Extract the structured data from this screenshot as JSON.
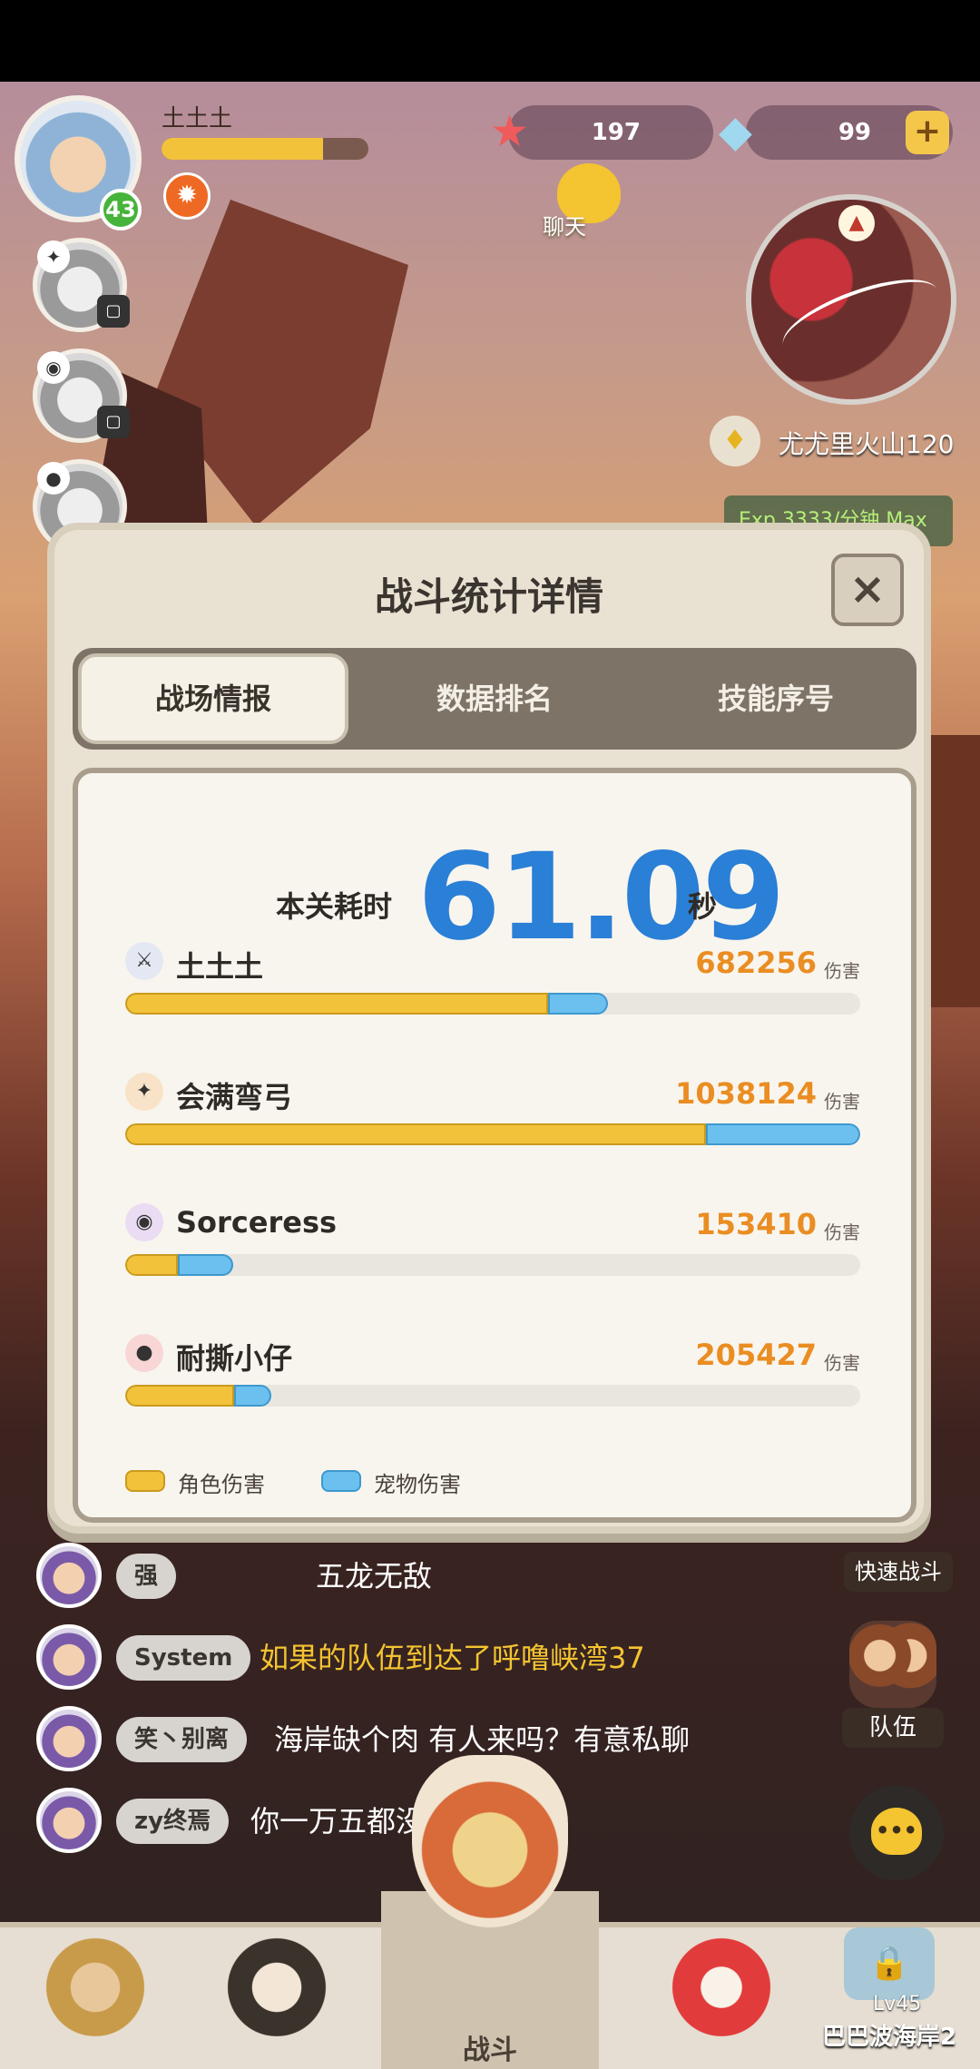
{
  "hud": {
    "player_name": "土土土",
    "player_level": "43",
    "exp_fraction": 0.78,
    "starfish_count": "197",
    "shell_count": "99",
    "chat_label": "聊天",
    "location_name": "尤尤里火山120",
    "exp_rate": "Exp 3333/分钟 Max"
  },
  "modal": {
    "title": "战斗统计详情",
    "close_label": "×",
    "tabs": [
      {
        "label": "战场情报",
        "active": true
      },
      {
        "label": "数据排名",
        "active": false
      },
      {
        "label": "技能序号",
        "active": false
      }
    ],
    "time_label": "本关耗时",
    "time_value": "61.09",
    "time_unit": "秒",
    "damage_unit": "伤害",
    "players": [
      {
        "name": "土土土",
        "damage": "682256",
        "char_fraction": 0.575,
        "pet_fraction": 0.082,
        "icon": "sword-class-icon"
      },
      {
        "name": "会满弯弓",
        "damage": "1038124",
        "char_fraction": 0.79,
        "pet_fraction": 0.21,
        "icon": "bow-class-icon"
      },
      {
        "name": "Sorceress",
        "damage": "153410",
        "char_fraction": 0.072,
        "pet_fraction": 0.075,
        "icon": "magic-class-icon"
      },
      {
        "name": "耐撕小仔",
        "damage": "205427",
        "char_fraction": 0.148,
        "pet_fraction": 0.05,
        "icon": "fire-class-icon"
      }
    ],
    "legend": {
      "char_label": "角色伤害",
      "pet_label": "宠物伤害",
      "char_color": "#f2c23a",
      "pet_color": "#6cc0ef"
    }
  },
  "chat": [
    {
      "sender": "强",
      "text": "五龙无敌",
      "system": false
    },
    {
      "sender": "System",
      "text": "如果的队伍到达了呼噜峡湾37",
      "system": true
    },
    {
      "sender": "笑丶别离",
      "text": "海岸缺个肉 有人来吗？有意私聊",
      "system": false
    },
    {
      "sender": "zy终焉",
      "text": "你一万五都没出去?",
      "system": false
    }
  ],
  "side": {
    "quick_battle": "快速战斗",
    "team_label": "队伍"
  },
  "nav": {
    "battle_label": "战斗",
    "map_level": "Lv45",
    "map_name": "巴巴波海岸2"
  }
}
